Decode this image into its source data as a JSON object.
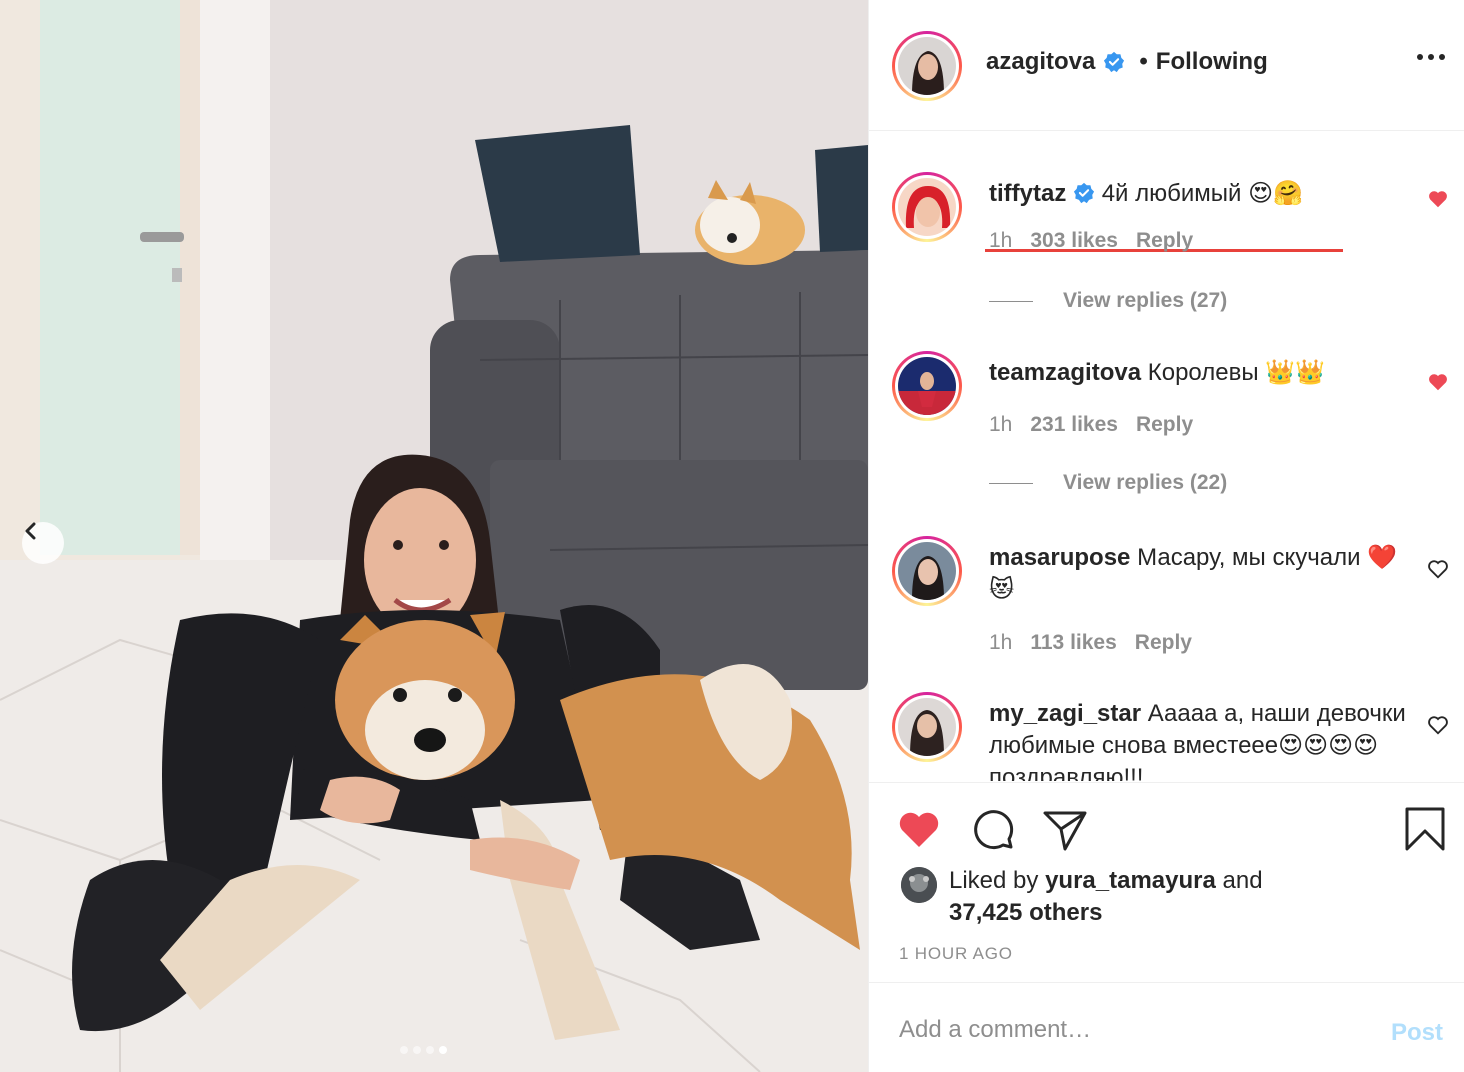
{
  "post": {
    "author": "azagitova",
    "follow_separator": "•",
    "follow_label": "Following",
    "verified": true,
    "carousel": {
      "total": 4,
      "active": 4
    }
  },
  "comments": [
    {
      "user": "tiffytaz",
      "verified": true,
      "text": "4й любимый 😍🤗",
      "time": "1h",
      "likes": "303 likes",
      "reply": "Reply",
      "view_replies": "View replies (27)",
      "liked": true,
      "highlighted": true
    },
    {
      "user": "teamzagitova",
      "verified": false,
      "text": "Королевы 👑👑",
      "time": "1h",
      "likes": "231 likes",
      "reply": "Reply",
      "view_replies": "View replies (22)",
      "liked": true
    },
    {
      "user": "masarupose",
      "verified": false,
      "text": "Масару, мы скучали ❤️😻",
      "time": "1h",
      "likes": "113 likes",
      "reply": "Reply",
      "liked": false
    },
    {
      "user": "my_zagi_star",
      "verified": false,
      "text": "Ааааа а, наши девочки любимые снова вместеее😍😍😍😍поздравляю!!!",
      "liked": false
    }
  ],
  "likes": {
    "prefix": "Liked by",
    "user": "yura_tamayura",
    "joiner": "and",
    "others": "37,425 others"
  },
  "timestamp": "1 HOUR AGO",
  "add_comment": {
    "placeholder": "Add a comment…",
    "post_label": "Post"
  },
  "colors": {
    "like_red": "#ed4956",
    "post_disabled": "#b2dffc",
    "verified_blue": "#3897f0",
    "highlight_red": "#e8413b"
  }
}
